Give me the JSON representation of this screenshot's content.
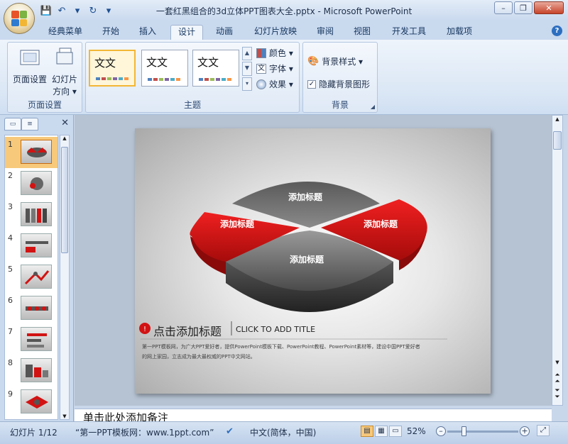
{
  "window": {
    "title": "一套红黑组合的3d立体PPT图表大全.pptx - Microsoft PowerPoint",
    "controls": {
      "minimize": "–",
      "restore": "❐",
      "close": "✕"
    }
  },
  "qat": {
    "save": "💾",
    "undo": "↶",
    "dropdown": "▾",
    "redo": "↻",
    "customize": "▾"
  },
  "tabs": [
    "经典菜单",
    "开始",
    "插入",
    "设计",
    "动画",
    "幻灯片放映",
    "审阅",
    "视图",
    "开发工具",
    "加载项"
  ],
  "active_tab": "设计",
  "help": "?",
  "ribbon": {
    "page_setup": {
      "btn1": "页面设置",
      "btn2_line1": "幻灯片",
      "btn2_line2": "方向 ▾",
      "group": "页面设置"
    },
    "themes": {
      "group": "主题",
      "sample": [
        "文文",
        "文文",
        "文文"
      ],
      "options": [
        {
          "label": "颜色 ▾"
        },
        {
          "label": "字体 ▾"
        },
        {
          "label": "效果 ▾"
        }
      ]
    },
    "background": {
      "style": "背景样式 ▾",
      "hide": "隐藏背景图形",
      "group": "背景"
    }
  },
  "slides": {
    "numbers": [
      "1",
      "2",
      "3",
      "4",
      "5",
      "6",
      "7",
      "8",
      "9"
    ],
    "selected": "1"
  },
  "slide": {
    "labels": {
      "top": "添加标题",
      "left": "添加标题",
      "right": "添加标题",
      "bottom": "添加标题"
    },
    "heading_cn": "点击添加标题",
    "heading_en": "CLICK TO ADD TITLE",
    "body_line1": "第一PPT模板网，为广大PPT爱好者，提供PowerPoint模板下载、PowerPoint教程、PowerPoint素材等，建设中国PPT爱好者",
    "body_line2": "的网上家园，立志成为最大最权威的PPT中文网站。"
  },
  "notes": {
    "placeholder": "单击此处添加备注"
  },
  "status": {
    "slide": "幻灯片 1/12",
    "theme": "“第一PPT模板网：www.1ppt.com”",
    "language": "中文(简体，中国)",
    "zoom": "52%"
  },
  "colors": {
    "accent_red": "#d21313",
    "dark_gray": "#4a4a4a",
    "ribbon_bg": "#dbe7f5"
  }
}
